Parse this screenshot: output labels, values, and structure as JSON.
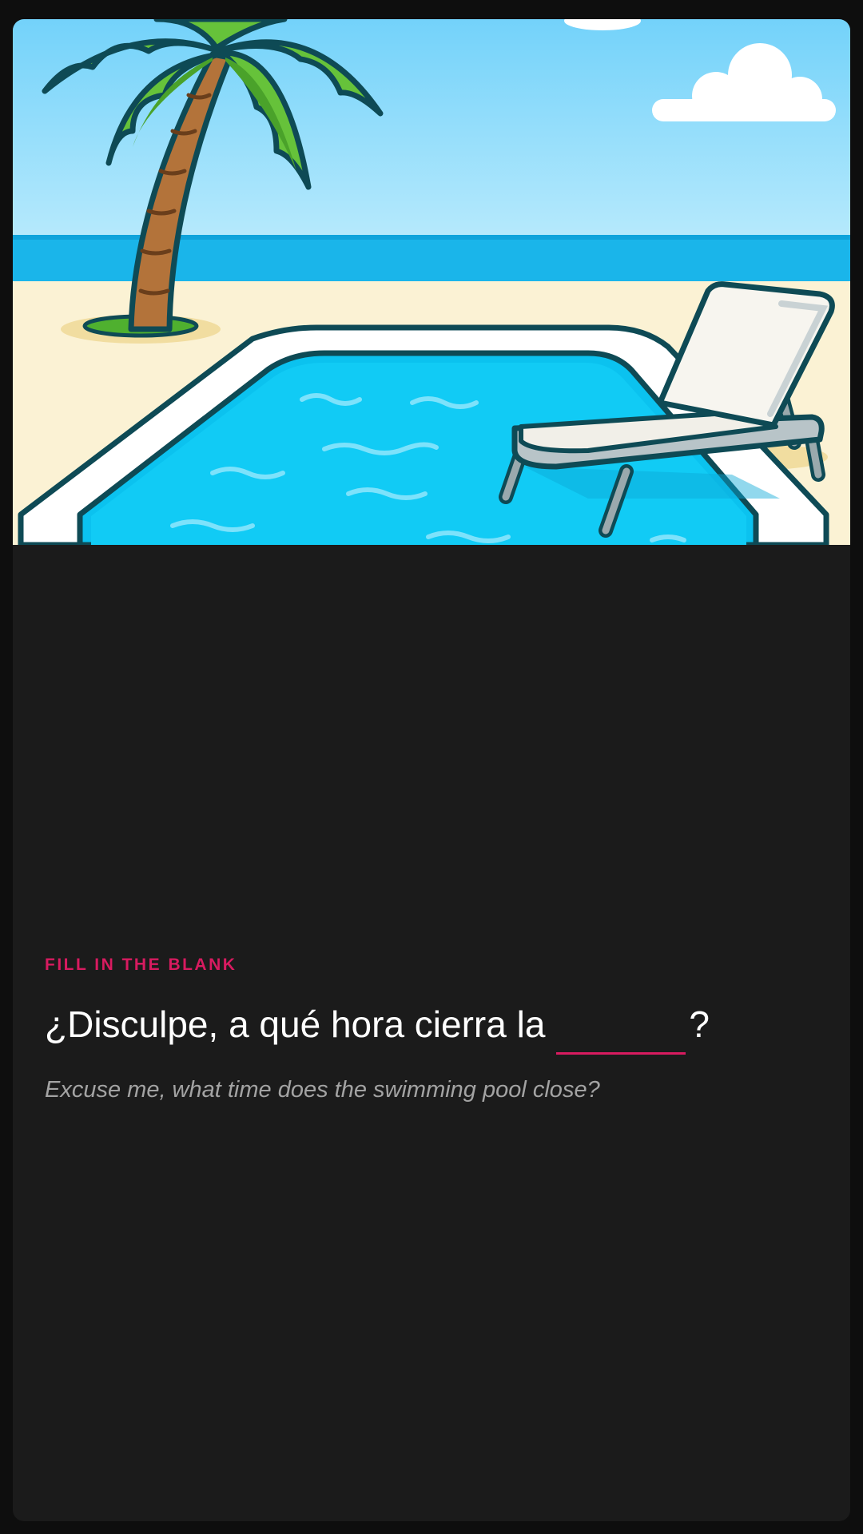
{
  "exercise": {
    "type_label": "FILL IN THE BLANK",
    "sentence_before": "¿Disculpe, a qué hora cierra la",
    "sentence_after": "?",
    "blank_value": "",
    "translation": "Excuse me, what time does the swimming pool close?"
  },
  "illustration": {
    "subject": "swimming pool with palm tree and lounge chair on a beach"
  },
  "colors": {
    "accent": "#d81b60",
    "background": "#0e0e0e",
    "card": "#1b1b1b",
    "text": "#ffffff",
    "muted": "#a3a3a3"
  }
}
